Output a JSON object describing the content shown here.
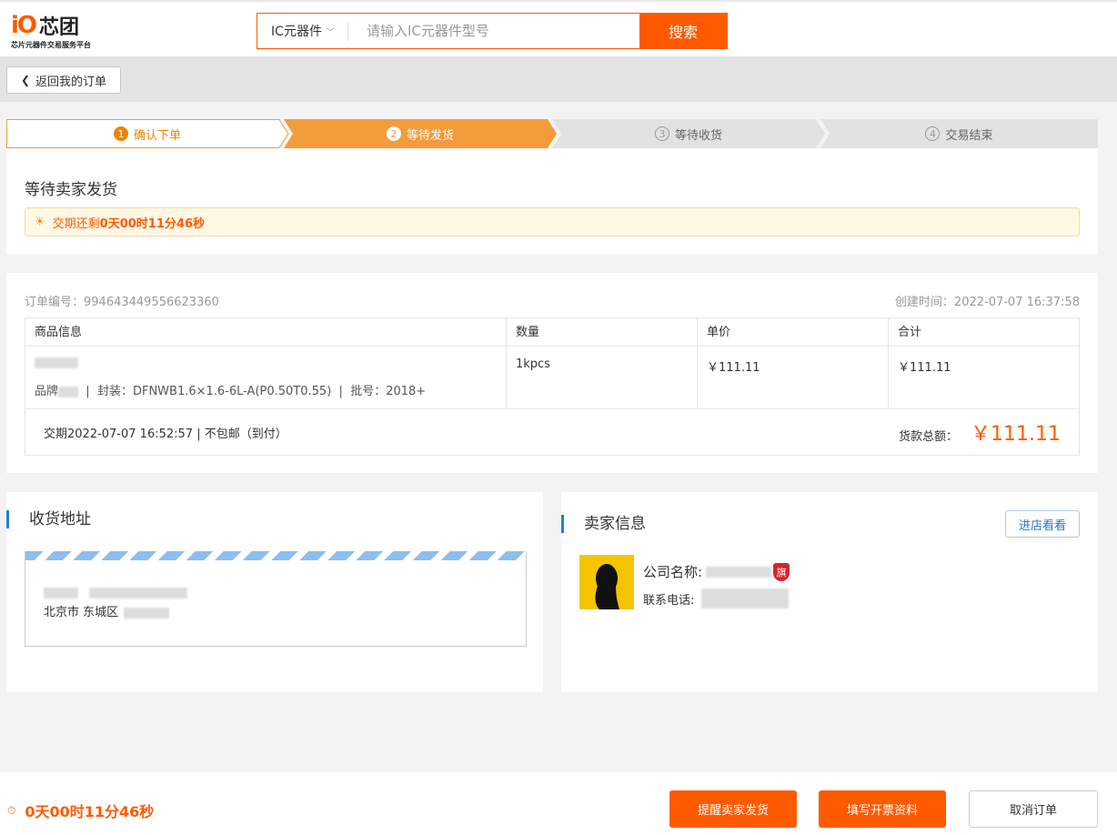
{
  "header": {
    "logo_mark": "iO",
    "logo_text": "芯团",
    "logo_sub": "芯片元器件交易服务平台",
    "search_category": "IC元器件",
    "search_placeholder": "请输入IC元器件型号",
    "search_button": "搜索"
  },
  "nav": {
    "back_label": "返回我的订单"
  },
  "steps": [
    {
      "num": "1",
      "label": "确认下单",
      "state": "done"
    },
    {
      "num": "2",
      "label": "等待发货",
      "state": "current"
    },
    {
      "num": "3",
      "label": "等待收货",
      "state": "pending"
    },
    {
      "num": "4",
      "label": "交易结束",
      "state": "pending"
    }
  ],
  "status": {
    "title": "等待卖家发货",
    "notice_prefix": "交期还剩",
    "notice_time": "0天00时11分46秒"
  },
  "order": {
    "number_label": "订单编号：",
    "number": "994643449556623360",
    "created_label": "创建时间：",
    "created": "2022-07-07 16:37:58",
    "columns": [
      "商品信息",
      "数量",
      "单价",
      "合计"
    ],
    "item": {
      "brand_label": "品牌",
      "package_label": "封装：",
      "package": "DFNWB1.6×1.6-6L-A(P0.50T0.55)",
      "batch_label": "批号：",
      "batch": "2018+",
      "quantity": "1kpcs",
      "unit_price": "￥111.11",
      "subtotal": "￥111.11"
    },
    "delivery": "交期2022-07-07 16:52:57 | 不包邮（到付）",
    "total_label": "货款总额：",
    "total": "￥111.11"
  },
  "address": {
    "title": "收货地址",
    "city": "北京市 东城区"
  },
  "seller": {
    "title": "卖家信息",
    "shop_button": "进店看看",
    "company_label": "公司名称:",
    "flag": "旗",
    "phone_label": "联系电话:"
  },
  "bottom": {
    "timer": "0天00时11分46秒",
    "remind_button": "提醒卖家发货",
    "invoice_button": "填写开票资料",
    "cancel_button": "取消订单"
  },
  "colors": {
    "accent": "#ff5a00",
    "step_active": "#f39c3c",
    "link": "#2a6fc9",
    "section_bar": "#1e7fe0"
  }
}
